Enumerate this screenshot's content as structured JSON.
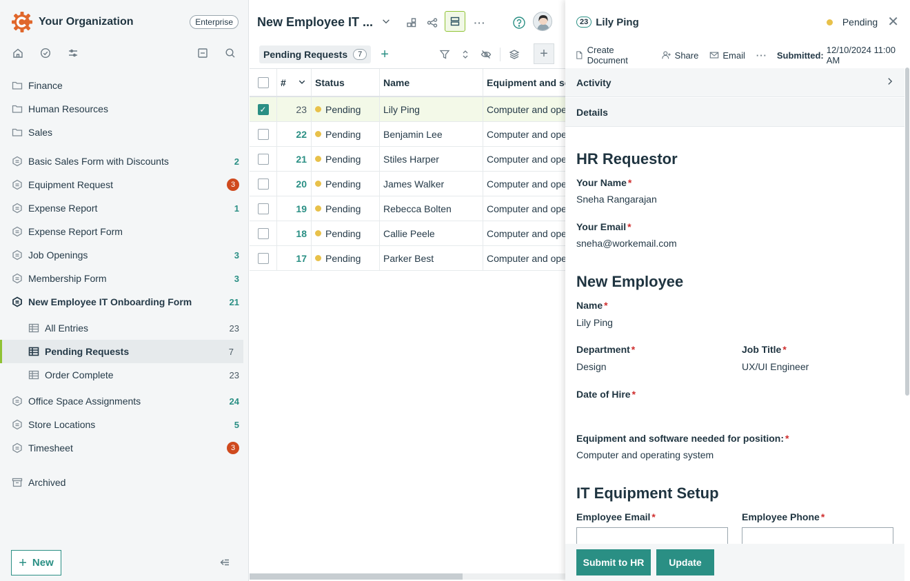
{
  "sidebar": {
    "org_name": "Your Organization",
    "plan": "Enterprise",
    "tools": [
      "home-icon",
      "check-circle-icon",
      "sliders-icon",
      "collapse-all-icon",
      "search-icon"
    ],
    "folders": [
      {
        "label": "Finance"
      },
      {
        "label": "Human Resources"
      },
      {
        "label": "Sales"
      }
    ],
    "forms": [
      {
        "label": "Basic Sales Form with Discounts",
        "count": "2",
        "type": "count"
      },
      {
        "label": "Equipment Request",
        "count": "3",
        "type": "alert"
      },
      {
        "label": "Expense Report",
        "count": "1",
        "type": "count"
      },
      {
        "label": "Expense Report Form",
        "count": "",
        "type": "none"
      },
      {
        "label": "Job Openings",
        "count": "3",
        "type": "count"
      },
      {
        "label": "Membership Form",
        "count": "3",
        "type": "count"
      },
      {
        "label": "New Employee IT Onboarding Form",
        "count": "21",
        "type": "count"
      }
    ],
    "views": [
      {
        "label": "All Entries",
        "count": "23"
      },
      {
        "label": "Pending Requests",
        "count": "7"
      },
      {
        "label": "Order Complete",
        "count": "23"
      }
    ],
    "forms2": [
      {
        "label": "Office Space Assignments",
        "count": "24",
        "type": "count"
      },
      {
        "label": "Store Locations",
        "count": "5",
        "type": "count"
      },
      {
        "label": "Timesheet",
        "count": "3",
        "type": "alert"
      }
    ],
    "archived": "Archived",
    "new_label": "New"
  },
  "main": {
    "title": "New Employee IT ...",
    "tab_label": "Pending Requests",
    "tab_count": "7",
    "columns": {
      "num": "#",
      "status": "Status",
      "name": "Name",
      "equip": "Equipment and so"
    },
    "rows": [
      {
        "num": "23",
        "status": "Pending",
        "name": "Lily Ping",
        "equip": "Computer and operating system",
        "selected": true
      },
      {
        "num": "22",
        "status": "Pending",
        "name": "Benjamin Lee",
        "equip": "Computer and operating system",
        "selected": false
      },
      {
        "num": "21",
        "status": "Pending",
        "name": "Stiles Harper",
        "equip": "Computer and operating system",
        "selected": false
      },
      {
        "num": "20",
        "status": "Pending",
        "name": "James Walker",
        "equip": "Computer and operating system",
        "selected": false
      },
      {
        "num": "19",
        "status": "Pending",
        "name": "Rebecca Bolten",
        "equip": "Computer and operating system",
        "selected": false
      },
      {
        "num": "18",
        "status": "Pending",
        "name": "Callie Peele",
        "equip": "Computer and operating system",
        "selected": false
      },
      {
        "num": "17",
        "status": "Pending",
        "name": "Parker Best",
        "equip": "Computer and operating system",
        "selected": false
      }
    ]
  },
  "panel": {
    "entry_id": "23",
    "title": "Lily Ping",
    "status": "Pending",
    "actions": {
      "create_doc": "Create Document",
      "share": "Share",
      "email": "Email"
    },
    "submitted_label": "Submitted:",
    "submitted_value": "12/10/2024 11:00 AM",
    "activity": "Activity",
    "details": "Details",
    "sections": {
      "hr": "HR Requestor",
      "employee": "New Employee",
      "it": "IT Equipment Setup"
    },
    "fields": {
      "your_name_label": "Your Name",
      "your_name": "Sneha Rangarajan",
      "your_email_label": "Your Email",
      "your_email": "sneha@workemail.com",
      "name_label": "Name",
      "name": "Lily Ping",
      "dept_label": "Department",
      "dept": "Design",
      "job_label": "Job Title",
      "job": "UX/UI Engineer",
      "hire_label": "Date of Hire",
      "equip_label": "Equipment and software needed for position:",
      "equip": "Computer and operating system",
      "emp_email_label": "Employee Email",
      "emp_phone_label": "Employee Phone"
    },
    "submit_hr": "Submit to HR",
    "update": "Update"
  },
  "colors": {
    "accent": "#2a8f84",
    "active_bar": "#8fc234",
    "pending": "#e8c14a",
    "alert": "#cf4a1e",
    "logo": "#e0672b"
  }
}
